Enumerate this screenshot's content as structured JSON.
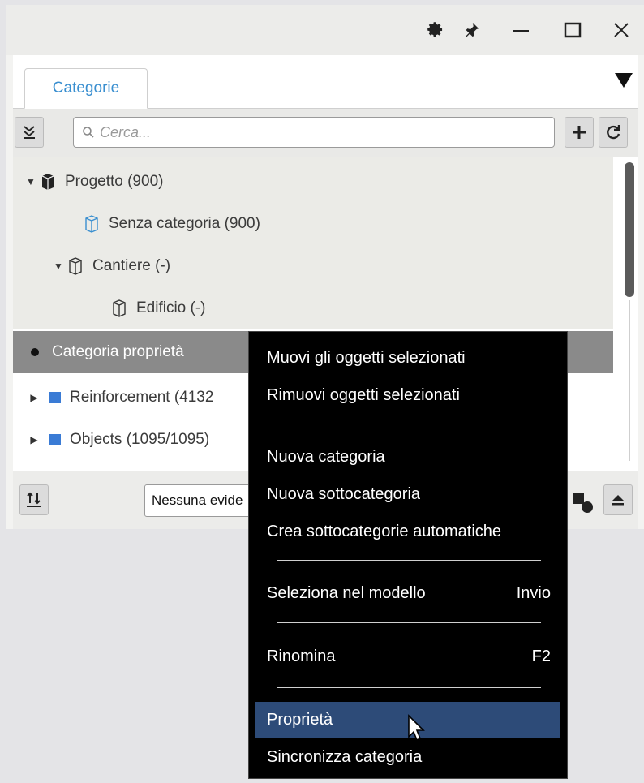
{
  "window": {
    "settings_icon": "gear-icon",
    "pin_icon": "pin-icon",
    "minimize_icon": "minimize-icon",
    "maximize_icon": "maximize-icon",
    "close_icon": "close-icon"
  },
  "tabs": [
    {
      "label": "Categorie"
    }
  ],
  "search": {
    "placeholder": "Cerca..."
  },
  "tree": {
    "items": [
      {
        "label": "Progetto (900)"
      },
      {
        "label": "Senza categoria (900)"
      },
      {
        "label": "Cantiere (-)"
      },
      {
        "label": "Edificio (-)"
      },
      {
        "label": "Categoria proprietà"
      },
      {
        "label": "Reinforcement (4132"
      },
      {
        "label": "Objects (1095/1095)"
      }
    ],
    "colors": {
      "blue": "#3a7bd5",
      "selected": "#8a8a8a"
    }
  },
  "bottom": {
    "highlight_value": "Nessuna evide"
  },
  "context_menu": {
    "items": [
      {
        "label": "Muovi gli oggetti selezionati",
        "shortcut": ""
      },
      {
        "label": "Rimuovi oggetti selezionati",
        "shortcut": ""
      },
      {
        "label": "Nuova categoria",
        "shortcut": ""
      },
      {
        "label": "Nuova sottocategoria",
        "shortcut": ""
      },
      {
        "label": "Crea sottocategorie automatiche",
        "shortcut": ""
      },
      {
        "label": "Seleziona nel modello",
        "shortcut": "Invio"
      },
      {
        "label": "Rinomina",
        "shortcut": "F2"
      },
      {
        "label": "Proprietà",
        "shortcut": ""
      },
      {
        "label": "Sincronizza categoria",
        "shortcut": ""
      }
    ],
    "highlight_color": "#2d4b78"
  }
}
